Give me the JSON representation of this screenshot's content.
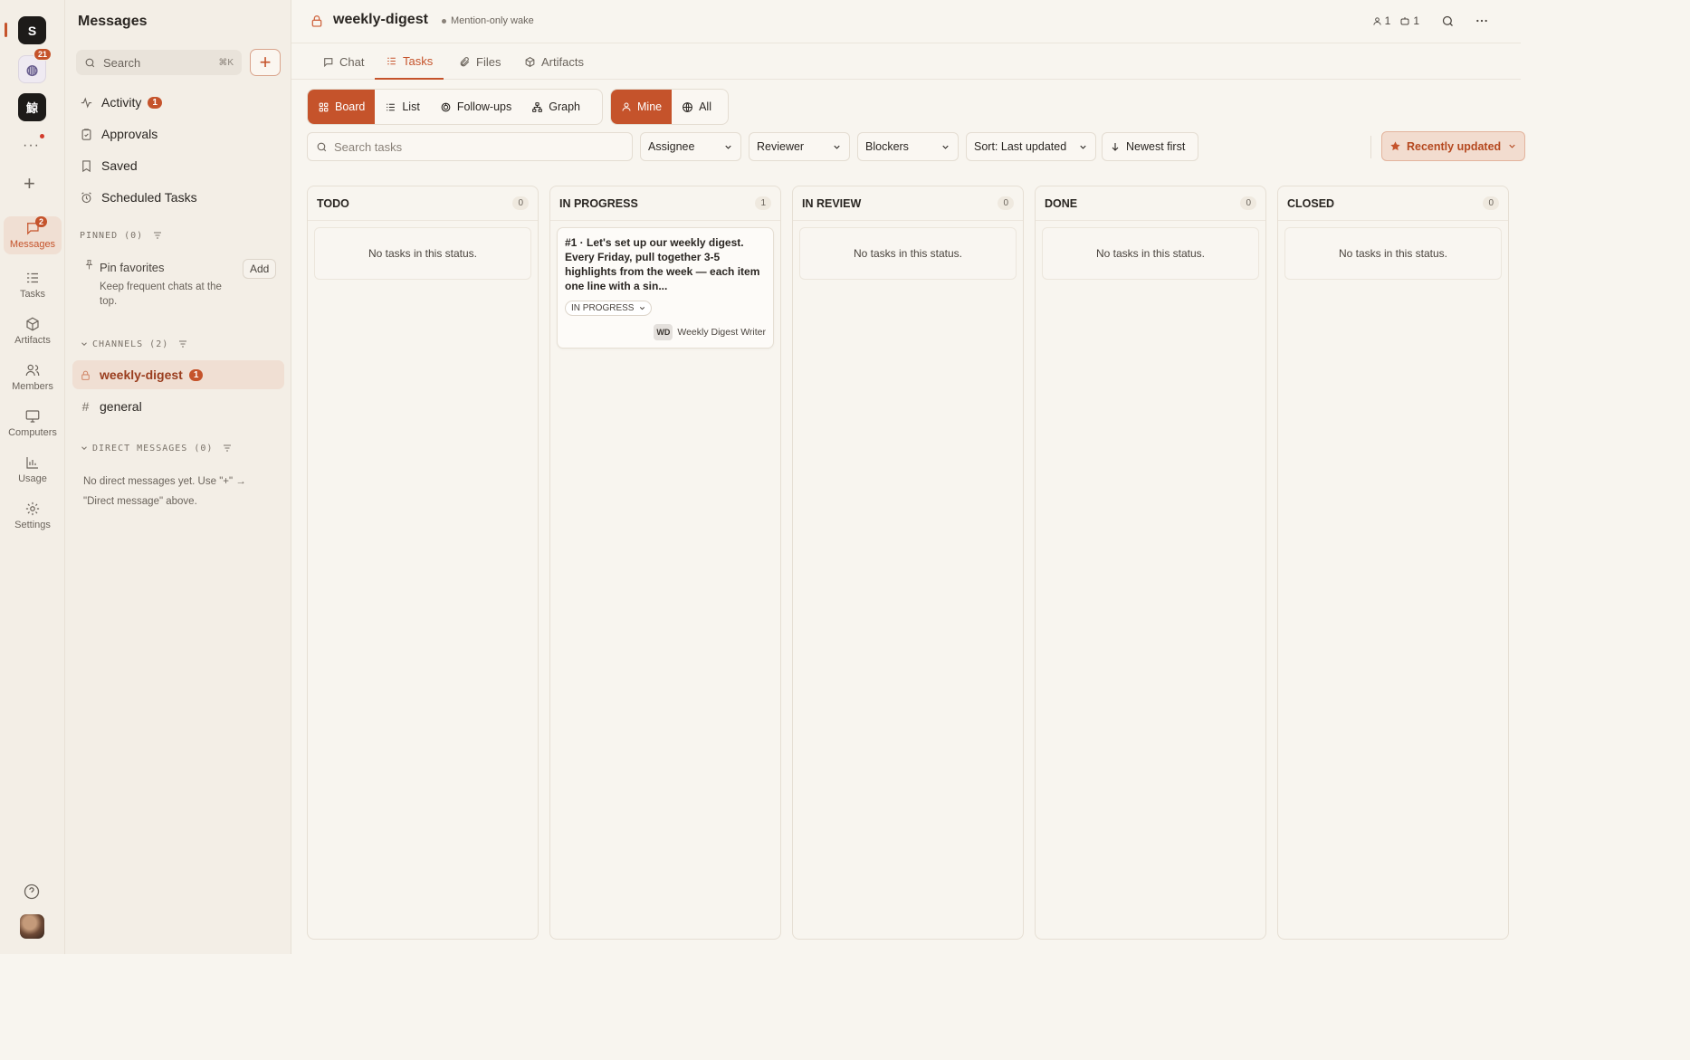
{
  "rail": {
    "workspaces": [
      {
        "label": "S"
      },
      {
        "label": "◍",
        "badge": "21"
      },
      {
        "label": "鯨"
      }
    ],
    "more": "···",
    "add": "+",
    "nav": [
      {
        "label": "Messages",
        "icon": "message-icon",
        "badge": "2",
        "active": true
      },
      {
        "label": "Tasks",
        "icon": "tasks-icon"
      },
      {
        "label": "Artifacts",
        "icon": "box-icon"
      },
      {
        "label": "Members",
        "icon": "members-icon"
      },
      {
        "label": "Computers",
        "icon": "monitor-icon"
      },
      {
        "label": "Usage",
        "icon": "chart-icon"
      },
      {
        "label": "Settings",
        "icon": "gear-icon"
      }
    ]
  },
  "sidebar": {
    "title": "Messages",
    "search_placeholder": "Search",
    "search_shortcut": "⌘K",
    "add_label": "+",
    "items": [
      {
        "label": "Activity",
        "badge": "1",
        "icon": "activity-icon"
      },
      {
        "label": "Approvals",
        "icon": "clipboard-check-icon"
      },
      {
        "label": "Saved",
        "icon": "bookmark-icon"
      },
      {
        "label": "Scheduled Tasks",
        "icon": "alarm-icon"
      }
    ],
    "pinned": {
      "label": "PINNED (0)",
      "card_title": "Pin favorites",
      "card_desc": "Keep frequent chats at the top.",
      "card_button": "Add"
    },
    "channels": {
      "label": "CHANNELS (2)",
      "items": [
        {
          "name": "weekly-digest",
          "badge": "1",
          "private": true,
          "active": true
        },
        {
          "name": "general",
          "private": false
        }
      ]
    },
    "dms": {
      "label": "DIRECT MESSAGES (0)",
      "empty": "No direct messages yet. Use \"+\" → \"Direct message\" above."
    }
  },
  "header": {
    "title": "weekly-digest",
    "wake": "Mention-only wake",
    "members_count": "1",
    "bots_count": "1"
  },
  "tabs": [
    {
      "label": "Chat",
      "icon": "chat-icon"
    },
    {
      "label": "Tasks",
      "icon": "tasks-icon",
      "active": true
    },
    {
      "label": "Files",
      "icon": "paperclip-icon"
    },
    {
      "label": "Artifacts",
      "icon": "box-icon"
    }
  ],
  "views": {
    "board": "Board",
    "list": "List",
    "followups": "Follow-ups",
    "graph": "Graph",
    "mine": "Mine",
    "all": "All"
  },
  "filters": {
    "search_placeholder": "Search tasks",
    "assignee": "Assignee",
    "reviewer": "Reviewer",
    "blockers": "Blockers",
    "sort": "Sort: Last updated",
    "order": "Newest first",
    "recent": "Recently updated"
  },
  "board": {
    "empty_text": "No tasks in this status.",
    "columns": [
      {
        "title": "TODO",
        "count": "0"
      },
      {
        "title": "IN PROGRESS",
        "count": "1"
      },
      {
        "title": "IN REVIEW",
        "count": "0"
      },
      {
        "title": "DONE",
        "count": "0"
      },
      {
        "title": "CLOSED",
        "count": "0"
      }
    ],
    "card": {
      "text": "#1 · Let's set up our weekly digest. Every Friday, pull together 3-5 highlights from the week — each item one line with a sin...",
      "status": "IN PROGRESS",
      "assignee_initials": "WD",
      "assignee_name": "Weekly Digest Writer"
    }
  },
  "colors": {
    "accent": "#c5532b",
    "accent_soft": "#f0dfd3",
    "background": "#f8f5ef",
    "sidebar": "#f3eee6"
  }
}
